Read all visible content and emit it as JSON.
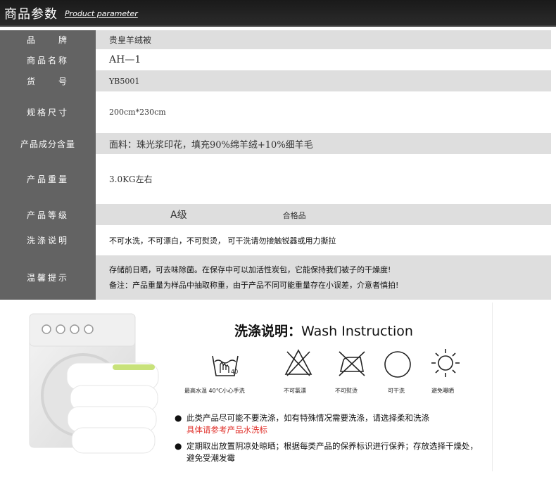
{
  "header": {
    "title_cn": "商品参数",
    "title_en": "Product parameter"
  },
  "params": [
    {
      "label": "品　　牌",
      "value": "贵皇羊绒被"
    },
    {
      "label": "商品名称",
      "value": "AH—1"
    },
    {
      "label": "货　　号",
      "value": "YB5001"
    },
    {
      "label": "规格尺寸",
      "value": "200cm*230cm"
    },
    {
      "label": "产品成分含量",
      "value": "面料：珠光浆印花，填充90%绵羊绒+10%细羊毛"
    },
    {
      "label": "产品重量",
      "value": "3.0KG左右"
    },
    {
      "label": "产品等级",
      "grade_a": "A级",
      "grade_b": "合格品"
    },
    {
      "label": "洗涤说明",
      "value": "不可水洗，不可漂白，不可熨烫， 可干洗请勿接触锐器或用力撕拉"
    },
    {
      "label": "温馨提示",
      "line1": "存储前日晒，可去味除菌。在保存中可以加活性炭包，它能保持我们被子的干燥度!",
      "line2": "备注：产品重量为样品中抽取称重，由于产品不同可能重量存在小误差，介意者慎拍!"
    }
  ],
  "wash": {
    "title_cn": "洗涤说明：",
    "title_en": "Wash Instruction",
    "icons": [
      {
        "name": "wash-40-icon",
        "label": "最高水温 40℃小心手洗"
      },
      {
        "name": "no-bleach-icon",
        "label": "不可氯漂"
      },
      {
        "name": "no-iron-icon",
        "label": "不可熨烫"
      },
      {
        "name": "dry-clean-icon",
        "label": "可干洗"
      },
      {
        "name": "avoid-sun-icon",
        "label": "避免曝晒"
      }
    ],
    "bullet1_a": "此类产品尽可能不要洗涤，如有特殊情况需要洗涤，请选择柔和洗涤",
    "bullet1_b": "具体请参考产品水洗标",
    "bullet2": "定期取出放置阴凉处晾晒；根据每类产品的保养标识进行保养；存放选择干燥处，避免受潮发霉",
    "bullet_mark": "●",
    "wash_temp": "40"
  },
  "colors": {
    "header_bg": "#222222",
    "label_bg": "#636363",
    "row_gray": "#dedede",
    "red": "#e0302a"
  }
}
